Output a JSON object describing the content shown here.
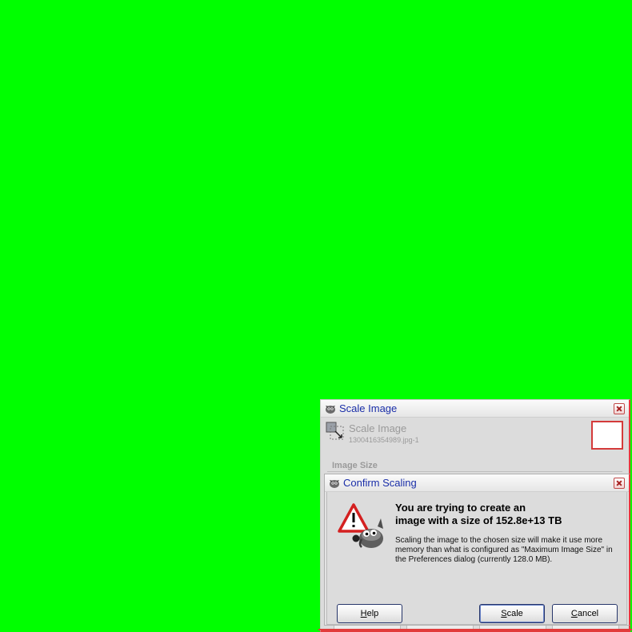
{
  "background_color": "#00ff00",
  "scale_image_window": {
    "title": "Scale Image",
    "header_title": "Scale Image",
    "header_subtitle": "1300416354989.jpg-1",
    "section_label": "Image Size",
    "icons": [
      "gimp-icon",
      "scale-image-icon",
      "close-icon"
    ]
  },
  "confirm_dialog": {
    "title": "Confirm Scaling",
    "primary_text_line1": "You are trying to create an",
    "primary_text_line2": "image with a size of 152.8e+13 TB",
    "secondary_text": "Scaling the image to the chosen size will make it use more memory than what is configured as \"Maximum Image Size\" in the Preferences dialog (currently 128.0 MB).",
    "buttons": {
      "help": {
        "mnemonic": "H",
        "rest": "elp"
      },
      "scale": {
        "mnemonic": "S",
        "rest": "cale"
      },
      "cancel": {
        "mnemonic": "C",
        "rest": "ancel"
      }
    },
    "accent_color": "#1a2ea8",
    "warning_color": "#d42020"
  }
}
